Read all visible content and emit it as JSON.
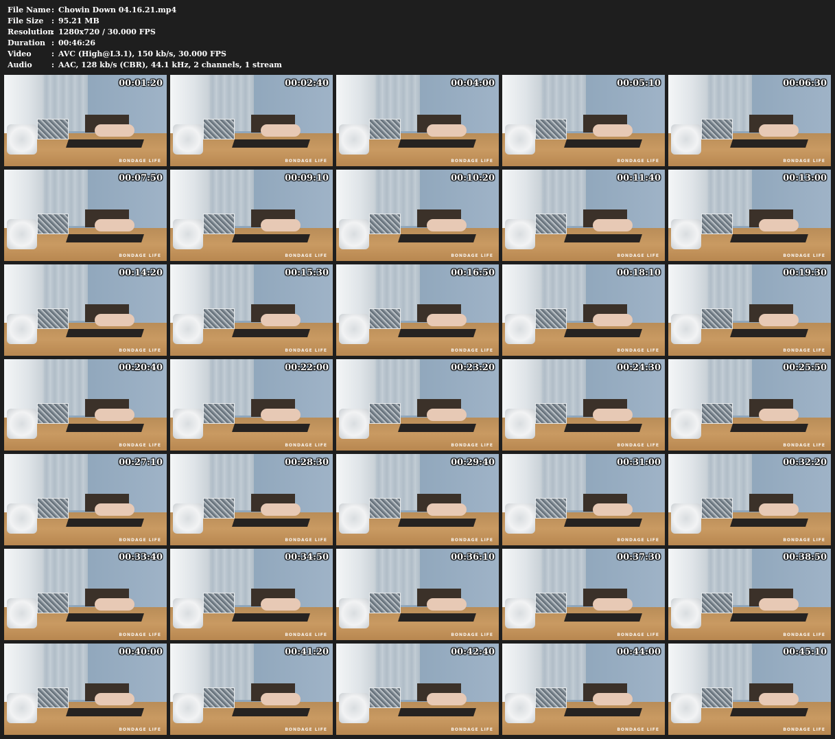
{
  "info": [
    {
      "label": "File Name",
      "value": "Chowin Down 04.16.21.mp4"
    },
    {
      "label": "File Size",
      "value": "95.21 MB"
    },
    {
      "label": "Resolution",
      "value": "1280x720 / 30.000 FPS"
    },
    {
      "label": "Duration",
      "value": "00:46:26"
    },
    {
      "label": "Video",
      "value": "AVC (High@L3.1), 150 kb/s, 30.000 FPS"
    },
    {
      "label": "Audio",
      "value": "AAC, 128 kb/s (CBR), 44.1 kHz, 2 channels, 1 stream"
    }
  ],
  "separator": ":",
  "watermark": "BONDAGE LIFE",
  "thumbnails": [
    "00:01:20",
    "00:02:40",
    "00:04:00",
    "00:05:10",
    "00:06:30",
    "00:07:50",
    "00:09:10",
    "00:10:20",
    "00:11:40",
    "00:13:00",
    "00:14:20",
    "00:15:30",
    "00:16:50",
    "00:18:10",
    "00:19:30",
    "00:20:40",
    "00:22:00",
    "00:23:20",
    "00:24:30",
    "00:25:50",
    "00:27:10",
    "00:28:30",
    "00:29:40",
    "00:31:00",
    "00:32:20",
    "00:33:40",
    "00:34:50",
    "00:36:10",
    "00:37:30",
    "00:38:50",
    "00:40:00",
    "00:41:20",
    "00:42:40",
    "00:44:00",
    "00:45:10"
  ]
}
